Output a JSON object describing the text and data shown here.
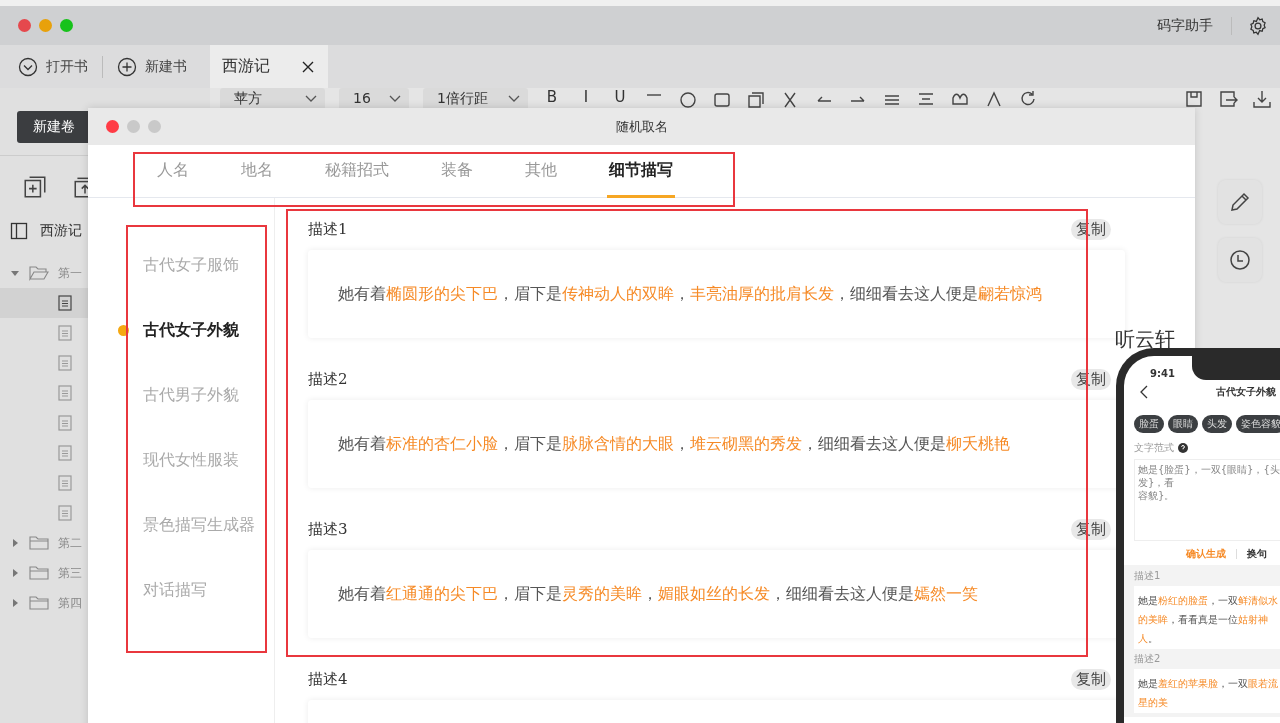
{
  "app": {
    "title": "码字助手"
  },
  "top_actions": [
    {
      "kind": "open",
      "label": "打开书"
    },
    {
      "kind": "new",
      "label": "新建书"
    }
  ],
  "document_tab": {
    "title": "西游记"
  },
  "toolbar": {
    "font": "苹方",
    "size": "16",
    "line_spacing": "1倍行距",
    "format_buttons": [
      "B",
      "I",
      "U"
    ]
  },
  "sidebar": {
    "new_volume": "新建卷",
    "book": "西游记",
    "tree": [
      {
        "label": "第一",
        "expanded": true,
        "children": [
          {
            "selected": true
          },
          {
            "selected": false
          },
          {
            "selected": false
          },
          {
            "selected": false
          },
          {
            "selected": false
          },
          {
            "selected": false
          },
          {
            "selected": false
          },
          {
            "selected": false
          }
        ]
      },
      {
        "label": "第二",
        "expanded": false
      },
      {
        "label": "第三",
        "expanded": false
      },
      {
        "label": "第四",
        "expanded": false
      }
    ]
  },
  "side_note": "听云轩",
  "dialog": {
    "title": "随机取名",
    "tabs": [
      {
        "label": "人名",
        "selected": false
      },
      {
        "label": "地名",
        "selected": false
      },
      {
        "label": "秘籍招式",
        "selected": false
      },
      {
        "label": "装备",
        "selected": false
      },
      {
        "label": "其他",
        "selected": false
      },
      {
        "label": "细节描写",
        "selected": true
      }
    ],
    "categories": [
      {
        "label": "古代女子服饰",
        "selected": false
      },
      {
        "label": "古代女子外貌",
        "selected": true
      },
      {
        "label": "古代男子外貌",
        "selected": false
      },
      {
        "label": "现代女性服装",
        "selected": false
      },
      {
        "label": "景色描写生成器",
        "selected": false
      },
      {
        "label": "对话描写",
        "selected": false
      }
    ],
    "descriptions": [
      {
        "label": "描述1",
        "copy": "复制",
        "segments": [
          {
            "text": "她有着",
            "highlight": false
          },
          {
            "text": "椭圆形的尖下巴",
            "highlight": true
          },
          {
            "text": "，眉下是",
            "highlight": false
          },
          {
            "text": "传神动人的双眸",
            "highlight": true
          },
          {
            "text": "，",
            "highlight": false
          },
          {
            "text": "丰亮油厚的批肩长发",
            "highlight": true
          },
          {
            "text": "，细细看去这人便是",
            "highlight": false
          },
          {
            "text": "翩若惊鸿",
            "highlight": true
          }
        ]
      },
      {
        "label": "描述2",
        "copy": "复制",
        "segments": [
          {
            "text": "她有着",
            "highlight": false
          },
          {
            "text": "标准的杏仁小脸",
            "highlight": true
          },
          {
            "text": "，眉下是",
            "highlight": false
          },
          {
            "text": "脉脉含情的大眼",
            "highlight": true
          },
          {
            "text": "，",
            "highlight": false
          },
          {
            "text": "堆云砌黑的秀发",
            "highlight": true
          },
          {
            "text": "，细细看去这人便是",
            "highlight": false
          },
          {
            "text": "柳夭桃艳",
            "highlight": true
          }
        ]
      },
      {
        "label": "描述3",
        "copy": "复制",
        "segments": [
          {
            "text": "她有着",
            "highlight": false
          },
          {
            "text": "红通通的尖下巴",
            "highlight": true
          },
          {
            "text": "，眉下是",
            "highlight": false
          },
          {
            "text": "灵秀的美眸",
            "highlight": true
          },
          {
            "text": "，",
            "highlight": false
          },
          {
            "text": "媚眼如丝的长发",
            "highlight": true
          },
          {
            "text": "，细细看去这人便是",
            "highlight": false
          },
          {
            "text": "嫣然一笑",
            "highlight": true
          }
        ]
      },
      {
        "label": "描述4",
        "copy": "复制"
      }
    ]
  },
  "phone": {
    "time": "9:41",
    "title": "古代女子外貌",
    "chips": [
      "脸蛋",
      "眼睛",
      "头发",
      "姿色容貌"
    ],
    "template_label": "文字范式",
    "template_lines": [
      "她是{脸蛋}，一双{眼睛}，{头发}，看",
      "容貌}。"
    ],
    "confirm": "确认生成",
    "switch": "换句",
    "descriptions": [
      {
        "label": "描述1",
        "segments": [
          {
            "text": "她是",
            "highlight": false
          },
          {
            "text": "粉红的脸蛋",
            "highlight": true
          },
          {
            "text": "，一双",
            "highlight": false
          },
          {
            "text": "鲜清似水的美眸",
            "highlight": true
          },
          {
            "text": "，看看真是一位",
            "highlight": false
          },
          {
            "text": "姑射神人",
            "highlight": true
          },
          {
            "text": "。",
            "highlight": false
          }
        ]
      },
      {
        "label": "描述2",
        "segments": [
          {
            "text": "她是",
            "highlight": false
          },
          {
            "text": "羞红的苹果脸",
            "highlight": true
          },
          {
            "text": "，一双",
            "highlight": false
          },
          {
            "text": "眼若流星的美",
            "highlight": true
          }
        ]
      }
    ]
  }
}
